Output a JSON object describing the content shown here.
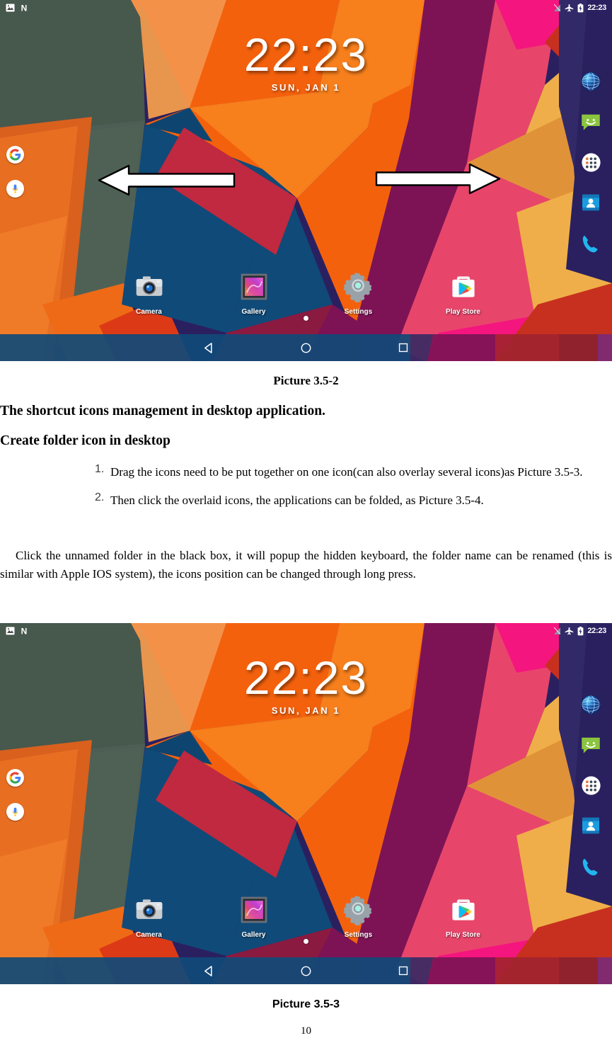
{
  "document": {
    "caption_1": "Picture 3.5-2",
    "caption_2": "Picture 3.5-3",
    "page_number": "10",
    "heading_1": "The shortcut icons management in desktop application.",
    "heading_2": "Create folder icon in desktop",
    "list": [
      {
        "num": "1.",
        "text": "Drag the icons need to be put together on one icon(can also overlay several icons)as Picture 3.5-3."
      },
      {
        "num": "2.",
        "text": "Then click the overlaid icons, the applications can be folded, as Picture 3.5-4."
      }
    ],
    "paragraph": "Click the unnamed folder in the black box, it will popup the hidden keyboard, the folder name can be renamed (this is similar with Apple IOS system), the icons position can be changed through long press."
  },
  "screenshot": {
    "statusbar": {
      "left_icons": [
        "screenshot-icon",
        "nfc-n-icon"
      ],
      "right_icons": [
        "signal-off-icon",
        "airplane-mode-icon",
        "battery-charging-icon"
      ],
      "time": "22:23"
    },
    "clock_widget": {
      "time": "22:23",
      "date": "SUN, JAN 1"
    },
    "left_widgets": [
      {
        "name": "google-search-icon",
        "label": "G"
      },
      {
        "name": "google-voice-search-icon",
        "label": "mic"
      }
    ],
    "right_dock": [
      {
        "name": "browser-icon",
        "label": "Browser"
      },
      {
        "name": "messaging-icon",
        "label": "Messaging"
      },
      {
        "name": "app-drawer-icon",
        "label": "Apps"
      },
      {
        "name": "contacts-icon",
        "label": "Contacts"
      },
      {
        "name": "phone-icon",
        "label": "Phone"
      }
    ],
    "hotseat": [
      {
        "name": "camera",
        "label": "Camera"
      },
      {
        "name": "gallery",
        "label": "Gallery"
      },
      {
        "name": "settings",
        "label": "Settings"
      },
      {
        "name": "play-store",
        "label": "Play Store"
      }
    ],
    "navbar": [
      {
        "name": "back-button",
        "glyph": "triangle-left"
      },
      {
        "name": "home-button",
        "glyph": "circle"
      },
      {
        "name": "recents-button",
        "glyph": "square"
      }
    ],
    "overlay_arrows": [
      {
        "name": "swipe-left-arrow",
        "direction": "left"
      },
      {
        "name": "swipe-right-arrow",
        "direction": "right"
      }
    ],
    "colors": {
      "wall_green": "#4a5c51",
      "wall_orange": "#f4610d",
      "wall_orange_light": "#f77f1c",
      "wall_amber": "#efae49",
      "wall_blue": "#104a78",
      "wall_crimson": "#c0293f",
      "wall_purple": "#7d1355",
      "wall_pink": "#e8456b",
      "wall_magenta": "#f5157e",
      "wall_navy": "#2a2060",
      "wall_red": "#c7301e",
      "nav_blue": "#104a78"
    }
  }
}
